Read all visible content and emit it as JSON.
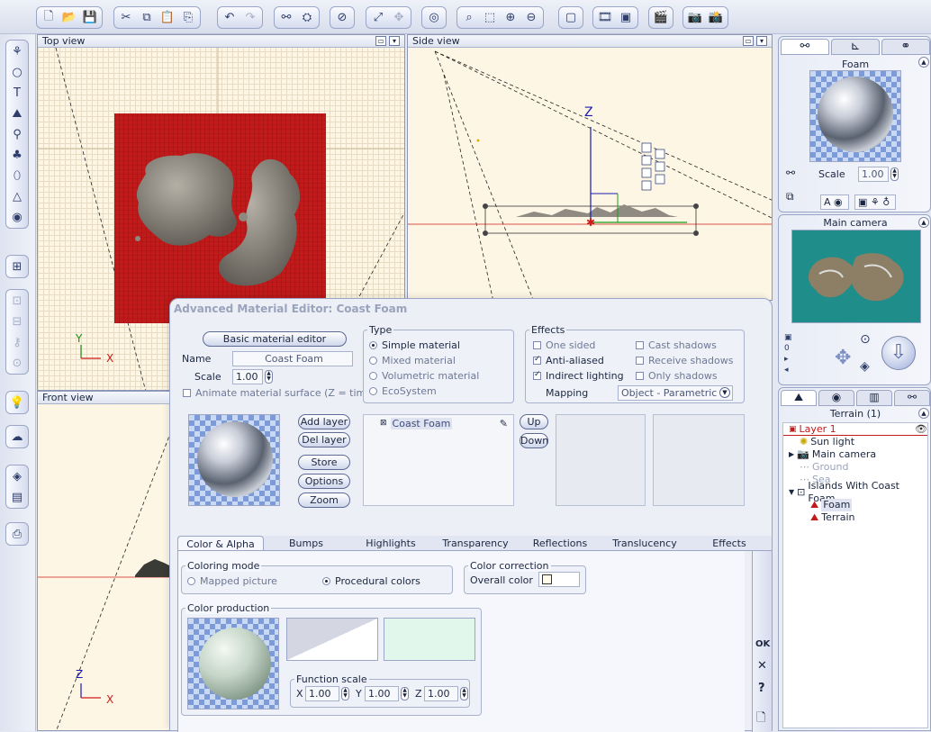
{
  "viewports": {
    "top": {
      "title": "Top view",
      "axis_y": "Y",
      "axis_x": "X"
    },
    "side": {
      "title": "Side view",
      "axis_z": "Z"
    },
    "front": {
      "title": "Front view",
      "axis_z": "Z",
      "axis_x": "X"
    }
  },
  "right_panel": {
    "object": {
      "title": "Foam",
      "scale_label": "Scale",
      "scale_value": "1.00",
      "align_label": "A"
    },
    "camera": {
      "title": "Main camera"
    },
    "tree": {
      "title": "Terrain (1)",
      "items": [
        {
          "label": "Layer 1",
          "kind": "layer"
        },
        {
          "label": "Sun light",
          "kind": "light"
        },
        {
          "label": "Main camera",
          "kind": "camera"
        },
        {
          "label": "Ground",
          "kind": "dim"
        },
        {
          "label": "Sea",
          "kind": "dim"
        },
        {
          "label": "Islands With Coast Foam",
          "kind": "group"
        },
        {
          "label": "Foam",
          "kind": "child-selected"
        },
        {
          "label": "Terrain",
          "kind": "child"
        }
      ]
    }
  },
  "editor": {
    "title": "Advanced Material Editor: Coast Foam",
    "basic_button": "Basic material editor",
    "name_label": "Name",
    "name_value": "Coast Foam",
    "scale_label": "Scale",
    "scale_value": "1.00",
    "animate_label": "Animate material surface (Z = time)",
    "type": {
      "label": "Type",
      "options": [
        "Simple material",
        "Mixed material",
        "Volumetric material",
        "EcoSystem"
      ],
      "selected": "Simple material"
    },
    "effects": {
      "label": "Effects",
      "one_sided": "One sided",
      "anti_aliased": "Anti-aliased",
      "indirect": "Indirect lighting",
      "cast": "Cast shadows",
      "receive": "Receive shadows",
      "only": "Only shadows",
      "mapping_label": "Mapping",
      "mapping_value": "Object - Parametric"
    },
    "layer_buttons": [
      "Add layer",
      "Del layer",
      "Store",
      "Options",
      "Zoom"
    ],
    "layer_item": "Coast Foam",
    "up": "Up",
    "down": "Down",
    "tabs": [
      "Color & Alpha",
      "Bumps",
      "Highlights",
      "Transparency",
      "Reflections",
      "Translucency",
      "Effects"
    ],
    "coloring": {
      "label": "Coloring mode",
      "mapped": "Mapped picture",
      "procedural": "Procedural colors"
    },
    "correction": {
      "label": "Color correction",
      "overall": "Overall color"
    },
    "production": {
      "label": "Color production"
    },
    "function_scale": {
      "label": "Function scale",
      "x_label": "X",
      "x": "1.00",
      "y_label": "Y",
      "y": "1.00",
      "z_label": "Z",
      "z": "1.00"
    },
    "side_buttons": {
      "ok": "OK",
      "cancel": "✕",
      "help": "?"
    }
  },
  "colors": {
    "terrain_red": "#c01a1a",
    "sea": "#1f8d8a",
    "accent": "#2e3f7a"
  }
}
